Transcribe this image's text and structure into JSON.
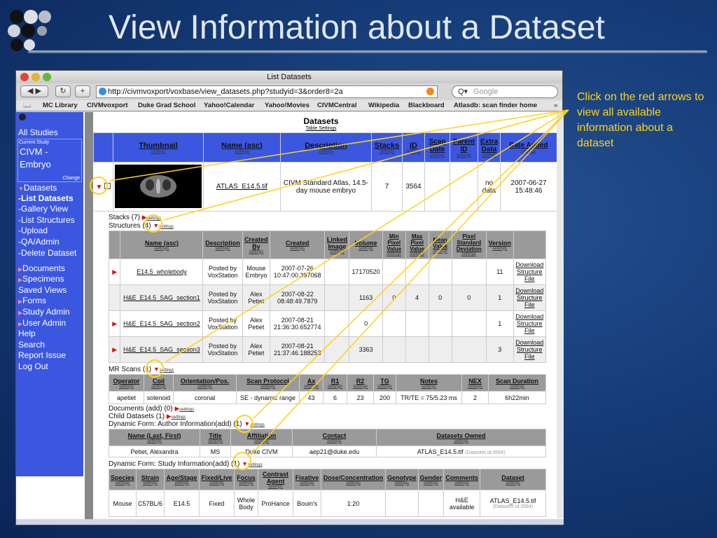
{
  "slide": {
    "title": "View Information about a Dataset",
    "callout": "Click on the red arrows to view all available information about a dataset"
  },
  "browser": {
    "window_title": "List Datasets",
    "url": "http://civmvoxport/voxbase/view_datasets.php?studyid=3&order8=2a",
    "search_placeholder": "Google",
    "bookmarks": [
      "MC Library",
      "CIVMvoxport",
      "Duke Grad School",
      "Yahoo!Calendar",
      "Yahoo!Movies",
      "CIVMCentral",
      "Wikipedia",
      "Blackboard",
      "Atlasdb: scan finder home"
    ]
  },
  "sidebar": {
    "all_studies": "All Studies",
    "current_study_label": "Current Study",
    "current_study": "CIVM - Embryo",
    "change": "Change",
    "datasets": "Datasets",
    "items": [
      "-List Datasets",
      "-Gallery View",
      "-List Structures",
      "-Upload",
      "-QA/Admin",
      "-Delete Dataset"
    ],
    "menu": [
      "Documents",
      "Specimens",
      "Saved Views",
      "Forms",
      "Study Admin",
      "User Admin",
      "Help",
      "Search",
      "Report Issue",
      "Log Out"
    ]
  },
  "datasets": {
    "heading": "Datasets",
    "table_settings": "Table Settings",
    "settings": "settings",
    "headers": [
      "Thumbnail",
      "Name (asc)",
      "Description",
      "Stacks",
      "ID",
      "Scan Date",
      "Parent ID",
      "Extra Data",
      "Date Added"
    ],
    "row": {
      "name": "ATLAS_E14.5.tif",
      "description": "CIVM Standard Atlas, 14.5-day mouse embryo",
      "stacks": "7",
      "id": "3564",
      "extra": "no data",
      "date_added": "2007-06-27 15:48:46"
    }
  },
  "stacks_label": "Stacks (7)",
  "structures_label": "Structures (4)",
  "structures": {
    "headers": [
      "Name (asc)",
      "Description",
      "Created By",
      "Created",
      "Linked Image",
      "Volume",
      "Min Pixel Value",
      "Max Pixel Value",
      "Mean Value",
      "Pixel Standard Deviation",
      "Version"
    ],
    "rows": [
      {
        "name": "E14.5_wholebody",
        "desc": "Posted by VoxStation",
        "by": "Mouse Embryo",
        "created": "2007-07-26 10:47:00.397068",
        "linked": "",
        "volume": "17170520",
        "min": "",
        "max": "",
        "mean": "",
        "std": "",
        "version": "11",
        "dl": "Download Structure File"
      },
      {
        "name": "H&E_E14.5_SAG_section1",
        "desc": "Posted by VoxStation",
        "by": "Alex Petiet",
        "created": "2007-08-22 08:48:49.7879",
        "linked": "",
        "volume": "1163",
        "min": "0",
        "max": "4",
        "mean": "0",
        "std": "0",
        "version": "1",
        "dl": "Download Structure File"
      },
      {
        "name": "H&E_E14.5_SAG_section2",
        "desc": "Posted by VoxStation",
        "by": "Alex Petiet",
        "created": "2007-08-21 21:36:30.652774",
        "linked": "",
        "volume": "0",
        "min": "",
        "max": "",
        "mean": "",
        "std": "",
        "version": "1",
        "dl": "Download Structure File"
      },
      {
        "name": "H&E_E14.5_SAG_section3",
        "desc": "Posted by VoxStation",
        "by": "Alex Petiet",
        "created": "2007-08-21 21:37:46.188253",
        "linked": "",
        "volume": "3363",
        "min": "",
        "max": "",
        "mean": "",
        "std": "",
        "version": "3",
        "dl": "Download Structure File"
      }
    ]
  },
  "mr_label": "MR Scans (1)",
  "mr": {
    "headers": [
      "Operator",
      "Coil",
      "Orientation/Pos.",
      "Scan Protocol",
      "Ax",
      "R1",
      "R2",
      "TG",
      "Notes",
      "NEX",
      "Scan Duration"
    ],
    "row": [
      "apetiet",
      "solenoid",
      "coronal",
      "SE - dynamic range",
      "43",
      "6",
      "23",
      "200",
      "TR/TE = 75/5.23 ms",
      "2",
      "6h22min"
    ]
  },
  "documents_label": "Documents (add) (0)",
  "child_label": "Child Datasets (1)",
  "author_label": "Dynamic Form: Author Information(add) (1)",
  "author": {
    "headers": [
      "Name (Last, First)",
      "Title",
      "Affiliation",
      "Contact",
      "Datasets Owned"
    ],
    "row": [
      "Petiet, Alexandra",
      "MS",
      "Duke CIVM",
      "aep21@duke.edu",
      "ATLAS_E14.5.tif"
    ],
    "owned_note": "(Datasets id:3564)"
  },
  "study_label": "Dynamic Form: Study Information(add) (1)",
  "study": {
    "headers": [
      "Species",
      "Strain",
      "Age/Stage",
      "Fixed/Live",
      "Focus",
      "Contrast Agent",
      "Fixative",
      "Dose/Concentration",
      "Genotype",
      "Gender",
      "Comments",
      "Dataset"
    ],
    "row": [
      "Mouse",
      "C57BL/6",
      "E14.5",
      "Fixed",
      "Whole Body",
      "ProHance",
      "Bouin's",
      "1:20",
      "",
      "",
      "H&E available",
      "ATLAS_E14.5.tif"
    ],
    "note": "(Datasets id:3564)"
  }
}
